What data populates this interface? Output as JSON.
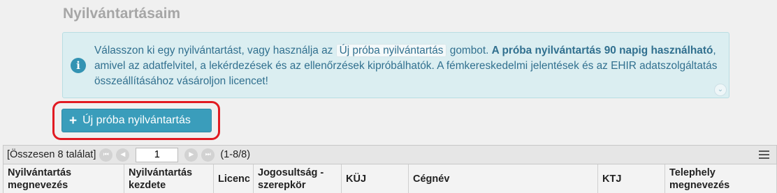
{
  "page": {
    "title": "Nyilvántartásaim"
  },
  "info": {
    "text_before": "Válasszon ki egy nyilvántartást, vagy használja az ",
    "inline_button": "Új próba nyilvántartás",
    "text_after": " gombot. ",
    "bold_text": "A próba nyilvántartás 90 napig használható",
    "text_end": ", amivel az adatfelvitel, a lekérdezések és az ellenőrzések kipróbálhatók. A fémkereskedelmi jelentések és az EHIR adatszolgáltatás összeállításához vásároljon licencet!",
    "icon": "info-icon",
    "expand_icon": "chevron-down-icon"
  },
  "actions": {
    "new_trial_label": "Új próba nyilvántartás",
    "highlight_color": "#e11a22"
  },
  "pager": {
    "total": "[Összesen 8 találat]",
    "page_value": "1",
    "range": "(1-8/8)",
    "first": "⏮",
    "prev": "◀",
    "next": "▶",
    "last": "⏭"
  },
  "table": {
    "columns": [
      "Nyilvántartás megnevezés",
      "Nyilvántartás kezdete",
      "Licenc",
      "Jogosultság - szerepkör",
      "KÜJ",
      "Cégnév",
      "KTJ",
      "Telephely megnevezés"
    ]
  },
  "colors": {
    "accent": "#3a9dbb",
    "info_bg": "#dbeef1",
    "info_text": "#31708f"
  }
}
